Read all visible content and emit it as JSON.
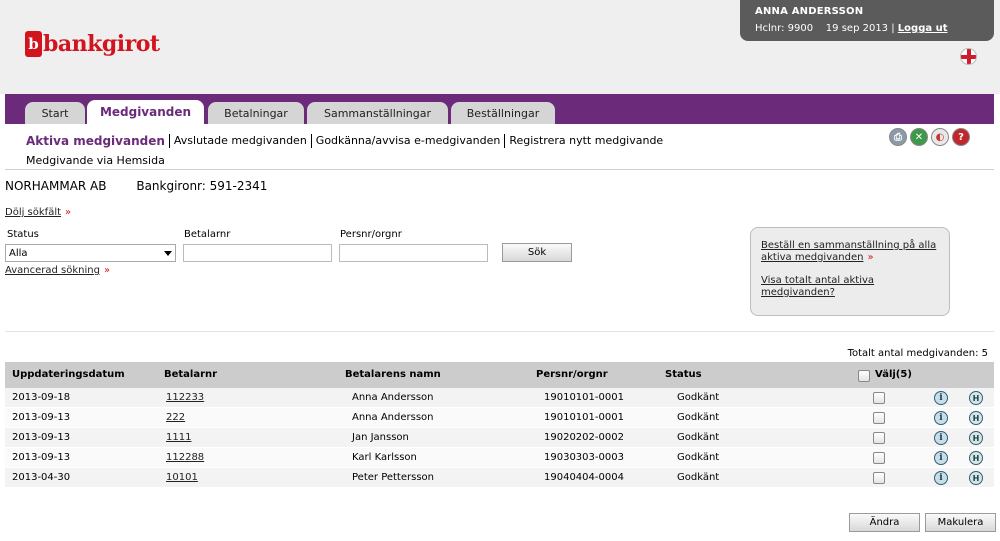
{
  "brand": {
    "logo_mark": "b",
    "name": "bankgirot"
  },
  "user": {
    "name": "ANNA ANDERSSON",
    "hclnr_label": "Hclnr: 9900",
    "date": "19 sep 2013",
    "separator": "|",
    "logout": "Logga ut"
  },
  "language_icon": "uk-flag-icon",
  "tabs": [
    {
      "label": "Start",
      "active": false
    },
    {
      "label": "Medgivanden",
      "active": true
    },
    {
      "label": "Betalningar",
      "active": false
    },
    {
      "label": "Sammanställningar",
      "active": false
    },
    {
      "label": "Beställningar",
      "active": false
    }
  ],
  "subnav": {
    "row1": [
      "Aktiva medgivanden",
      "Avslutade medgivanden",
      "Godkänna/avvisa e-medgivanden",
      "Registrera nytt medgivande"
    ],
    "row2": [
      "Medgivande via Hemsida"
    ],
    "tools": [
      "print-icon",
      "excel-icon",
      "pdf-icon",
      "help-icon"
    ],
    "tool_glyphs": [
      "⎙",
      "✕",
      "◐",
      "?"
    ]
  },
  "company": {
    "name": "NORHAMMAR AB",
    "bankgiro": "Bankgironr: 591-2341"
  },
  "search": {
    "hide_link": "Dölj sökfält",
    "raquo": "»",
    "status_label": "Status",
    "status_value": "Alla",
    "betalarnr_label": "Betalarnr",
    "betalarnr_value": "",
    "persnr_label": "Persnr/orgnr",
    "persnr_value": "",
    "search_button": "Sök",
    "advanced_link": "Avancerad sökning"
  },
  "infobox": {
    "link1": "Beställ en sammanställning på alla aktiva medgivanden",
    "link2": "Visa totalt antal aktiva medgivanden?"
  },
  "total": "Totalt antal medgivanden: 5",
  "table": {
    "headers": {
      "date": "Uppdateringsdatum",
      "betalarnr": "Betalarnr",
      "name": "Betalarens namn",
      "persnr": "Persnr/orgnr",
      "status": "Status",
      "select": "Välj(5)"
    },
    "rows": [
      {
        "date": "2013-09-18",
        "betalarnr": "112233",
        "name": "Anna Andersson",
        "persnr": "19010101-0001",
        "status": "Godkänt"
      },
      {
        "date": "2013-09-13",
        "betalarnr": "222",
        "name": "Anna Andersson",
        "persnr": "19010101-0001",
        "status": "Godkänt"
      },
      {
        "date": "2013-09-13",
        "betalarnr": "1111",
        "name": "Jan Jansson",
        "persnr": "19020202-0002",
        "status": "Godkänt"
      },
      {
        "date": "2013-09-13",
        "betalarnr": "112288",
        "name": "Karl Karlsson",
        "persnr": "19030303-0003",
        "status": "Godkänt"
      },
      {
        "date": "2013-04-30",
        "betalarnr": "10101",
        "name": "Peter Pettersson",
        "persnr": "19040404-0004",
        "status": "Godkänt"
      }
    ],
    "info_glyph": "i",
    "history_glyph": "H"
  },
  "actions": {
    "change": "Ändra",
    "cancel": "Makulera"
  },
  "colors": {
    "brand_red": "#d2141e",
    "nav_purple": "#6b2a7a",
    "user_box": "#5b5b5b"
  }
}
